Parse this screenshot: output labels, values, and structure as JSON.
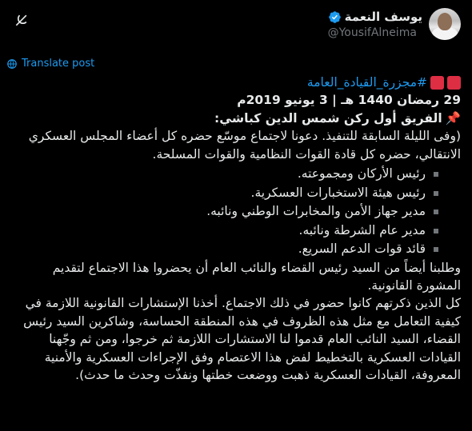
{
  "header": {
    "display_name": "يوسف النعمة",
    "handle": "@YousifAlneima",
    "verified": true,
    "accent": "#1d9bf0"
  },
  "icons": {
    "grok": "grok-icon",
    "verified": "verified-badge-icon",
    "translate": "translate-globe-icon",
    "pin": "pushpin-icon"
  },
  "translate": {
    "label": "Translate post"
  },
  "tweet": {
    "hashtag": "#مجزرة_القيادة_العامة",
    "date_line": "29 رمضان 1440 هـ | 3 يونيو 2019م",
    "speaker_line": "الفريق أول ركن شمس الدين كباشي:",
    "para1": "(وفى الليلة السابقة للتنفيذ. دعونا لاجتماع موسّع حضره كل أعضاء المجلس العسكري الانتقالي، حضره كل قادة القوات النظامية والقوات المسلحة.",
    "bullets": [
      "رئيس الأركان ومجموعته.",
      "رئيس هيئة الاستخبارات العسكرية.",
      "مدير جهاز الأمن والمخابرات الوطني ونائبه.",
      "مدير عام الشرطة ونائبه.",
      "قائد قوات الدعم السريع."
    ],
    "para2": "وطلبنا أيضاً من السيد رئيس القضاء والنائب العام أن يحضروا هذا الاجتماع لتقديم المشورة القانونية.",
    "para3": "كل الذين ذكرتهم كانوا حضور في ذلك الاجتماع. أخذنا الإستشارات القانونية اللازمة في كيفية التعامل مع مثل هذه الظروف في هذه المنطقة الحساسة، وشاكرين السيد رئيس القضاء، السيد النائب العام قدموا لنا الاستشارات اللازمة ثم خرجوا، ومن ثم وجّهنا القيادات العسكرية بالتخطيط لفض هذا الاعتصام وفق الإجراءات العسكرية والأمنية المعروفة، القيادات العسكرية ذهبت ووضعت خطتها ونفذّت وحدث ما حدث)."
  }
}
